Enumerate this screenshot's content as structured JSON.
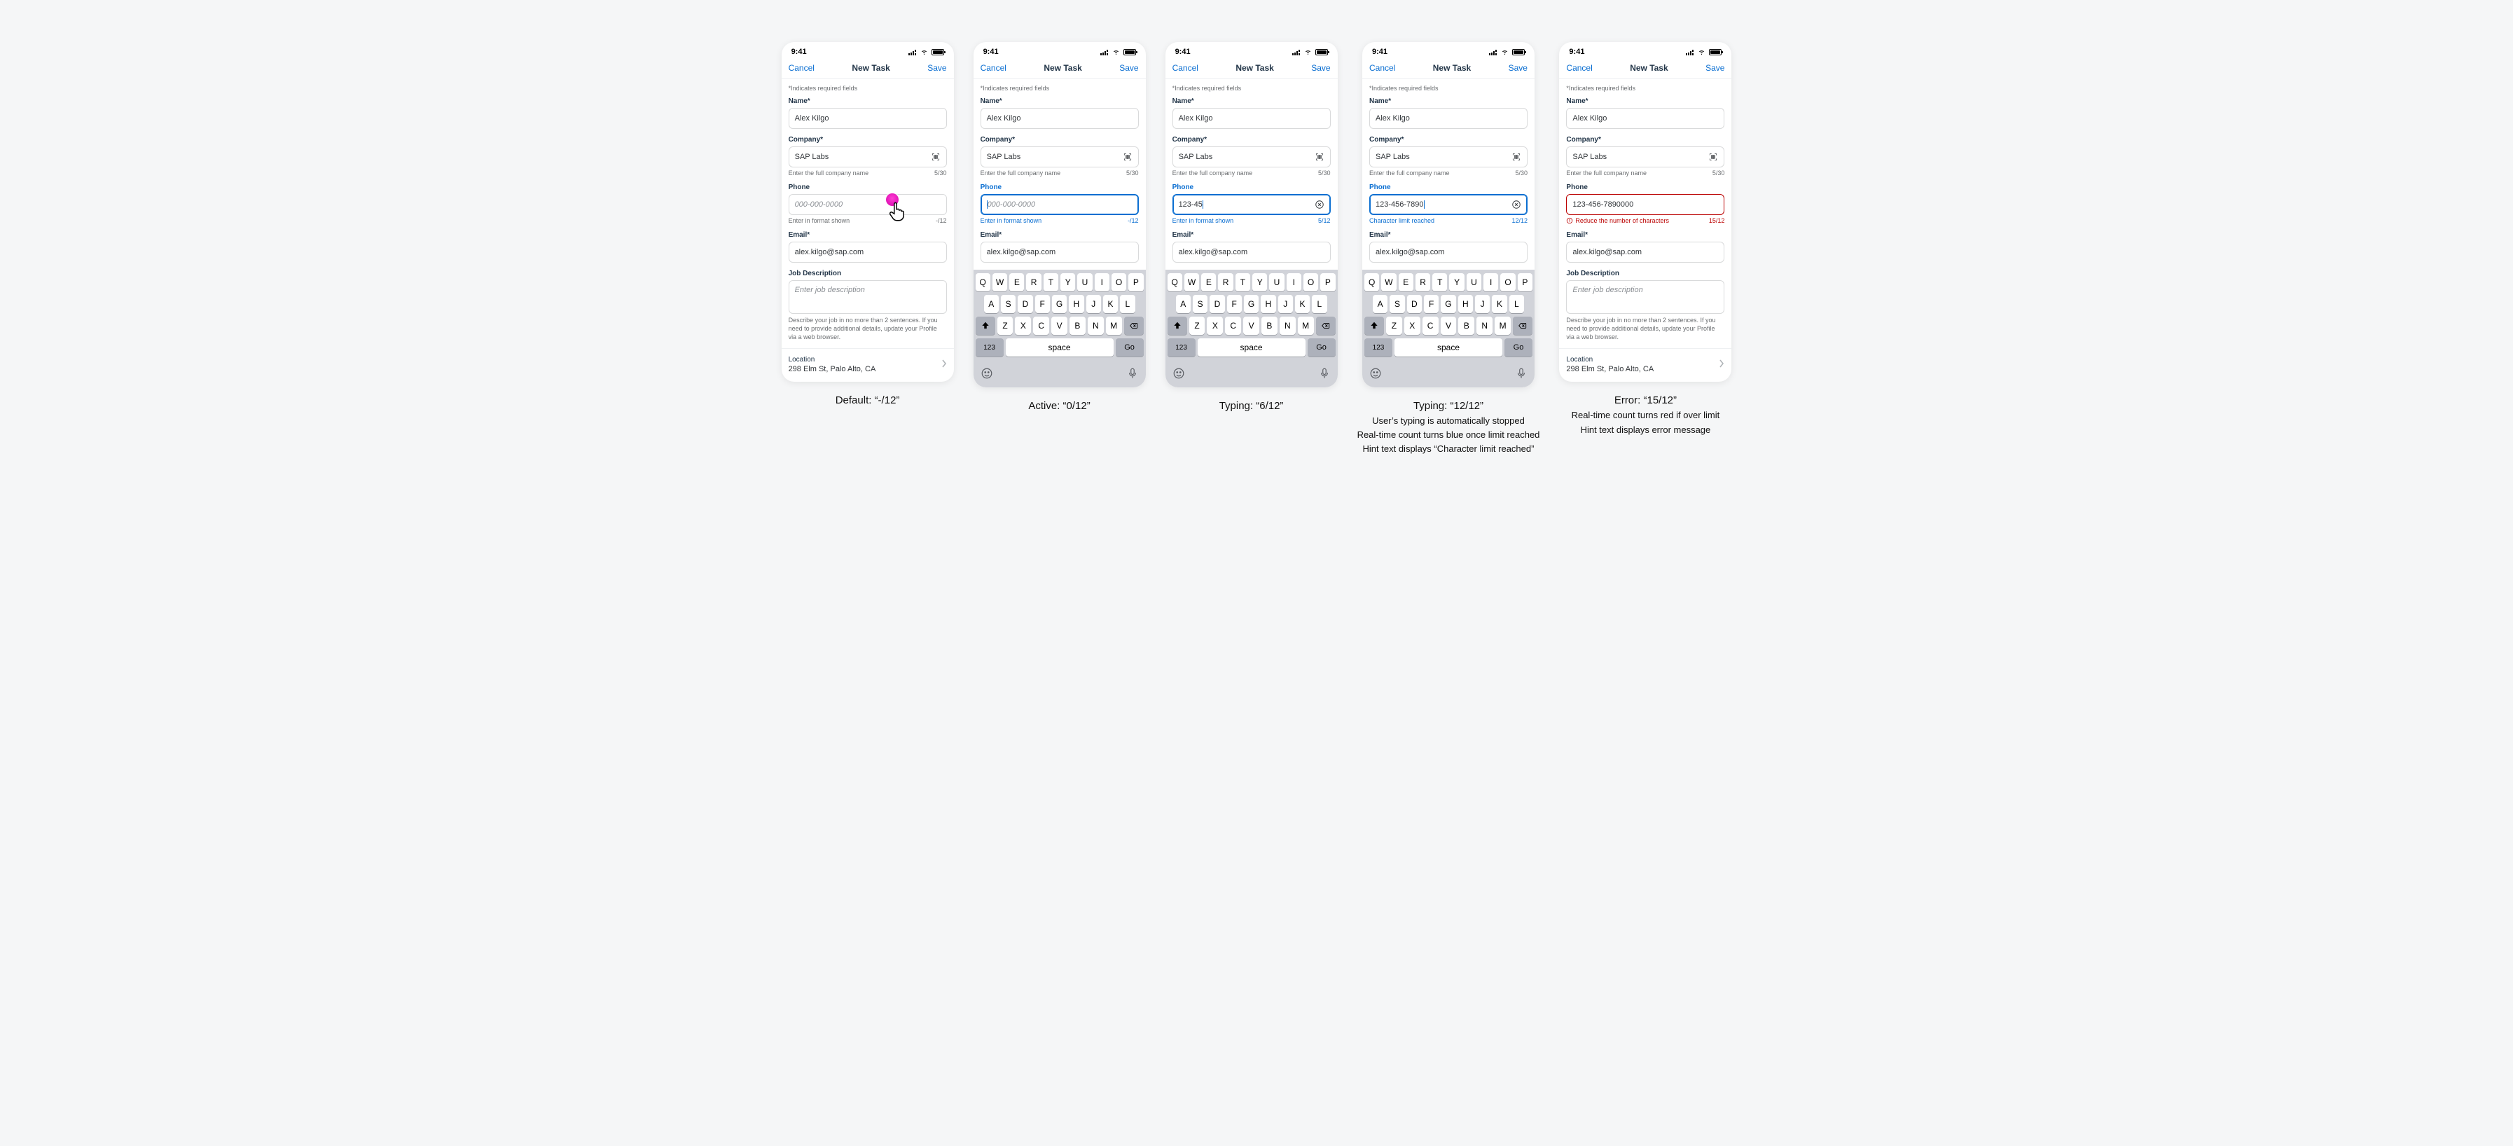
{
  "statusbar": {
    "time": "9:41"
  },
  "nav": {
    "cancel": "Cancel",
    "title": "New Task",
    "save": "Save"
  },
  "required_note": "*Indicates required fields",
  "fields": {
    "name": {
      "label": "Name*",
      "value": "Alex Kilgo"
    },
    "company": {
      "label": "Company*",
      "value": "SAP Labs",
      "hint": "Enter the full company name",
      "counter": "5/30"
    },
    "phone": {
      "label": "Phone",
      "placeholder": "000-000-0000",
      "hint_default": "Enter in format shown",
      "hint_limit": "Character limit reached",
      "hint_error": "Reduce the number of characters",
      "counter_default": "-/12",
      "counter_active": "-/12",
      "counter_typing1": "5/12",
      "counter_typing2": "12/12",
      "counter_error": "15/12",
      "value_typing1": "123-45",
      "value_typing2": "123-456-7890",
      "value_error": "123-456-7890000"
    },
    "email": {
      "label": "Email*",
      "value": "alex.kilgo@sap.com"
    },
    "job": {
      "label": "Job Description",
      "placeholder": "Enter job description",
      "helper": "Describe your job in no more than 2 sentences. If you need to provide additional details, update your Profile via a web browser."
    },
    "location": {
      "label": "Location",
      "value": "298 Elm St, Palo Alto, CA"
    }
  },
  "keyboard": {
    "r1": [
      "Q",
      "W",
      "E",
      "R",
      "T",
      "Y",
      "U",
      "I",
      "O",
      "P"
    ],
    "r2": [
      "A",
      "S",
      "D",
      "F",
      "G",
      "H",
      "J",
      "K",
      "L"
    ],
    "r3": [
      "Z",
      "X",
      "C",
      "V",
      "B",
      "N",
      "M"
    ],
    "k123": "123",
    "space": "space",
    "go": "Go"
  },
  "captions": {
    "c1": "Default: “-/12”",
    "c2": "Active: “0/12”",
    "c3": "Typing: “6/12”",
    "c4_main": "Typing: “12/12”",
    "c4_l1": "User’s typing is automatically stopped",
    "c4_l2": "Real-time count turns blue once limit reached",
    "c4_l3": "Hint text displays “Character limit reached”",
    "c5_main": "Error: “15/12”",
    "c5_l1": "Real-time count turns red if over limit",
    "c5_l2": "Hint text displays error message"
  }
}
